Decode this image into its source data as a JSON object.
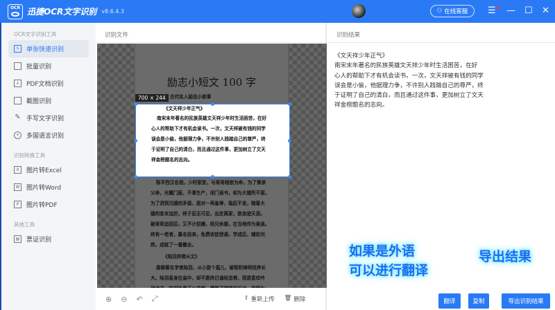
{
  "app": {
    "logo_text": "OCR",
    "title": "迅捷OCR文字识别",
    "version": "v8.6.4.3",
    "service": "在线客服",
    "menu_icon": "menu-icon",
    "min_icon": "minimize-icon",
    "max_icon": "maximize-icon",
    "close_icon": "close-icon"
  },
  "sidebar": {
    "sections": [
      {
        "title": "OCR文字识别工具",
        "items": [
          {
            "label": "单张快速识别",
            "active": true
          },
          {
            "label": "批量识别"
          },
          {
            "label": "PDF文档识别"
          },
          {
            "label": "截图识别"
          },
          {
            "label": "手写文字识别"
          },
          {
            "label": "多国语言识别"
          }
        ]
      },
      {
        "title": "识别转换工具",
        "items": [
          {
            "label": "图片转Excel",
            "icon_letter": "X"
          },
          {
            "label": "图片转Word",
            "icon_letter": "W"
          },
          {
            "label": "图片转PDF",
            "icon_letter": "P"
          }
        ]
      },
      {
        "title": "其他工具",
        "items": [
          {
            "label": "票证识别"
          }
        ]
      }
    ]
  },
  "file_panel": {
    "title": "识别文件",
    "selection_size": "700 × 244",
    "doc": {
      "title": "励志小短文 100 字",
      "lines": [
        "古代名人励志小故事",
        "《文天祥少年正气》",
        "南宋末年著名的民族英雄文天祥少年时生活困苦，在好",
        "心人的帮助下才有机会读书。一次，文天祥被有钱的同学",
        "误会是小偷，他据理力争，不许别人践踏自己的尊严，终",
        "于证明了自己的清白，而且通过这件事，更加树立了文天",
        "祥金榜题名的志向。",
        "《陈平忍辱苦读书》",
        "陈平西汉名相，少时家贫，与哥哥相依为命，为了秉承",
        "父命，光耀门庭，不事生产，闭门读书，却为大嫂所不容。",
        "为了消弭兄嫂的矛盾，面对一再羞辱，隐忍不发，随着大",
        "嫂的变本加厉，终于忍无可忍，出走离家，欲浪迹天涯。",
        "被哥哥追回后，又不计前嫌，阻兄休嫂，在当地传为美谈。",
        "终有一老者，慕名前来，免费收徒授课，学成后，辅佐刘",
        "邦，成就了一番霸业。",
        "《陆羽弃佛从文》",
        "唐朝著名学者陆羽，从小是个孤儿，被智积禅师抚养长",
        "大。陆羽虽身在庙中，却不愿终日诵经念佛，而是喜欢吟",
        "读诗书。陆羽执意下山求学，遭到了禅师的反对。禅师为"
      ]
    },
    "toolbar": {
      "zoom_in": "zoom-in-icon",
      "zoom_out": "zoom-out-icon",
      "rotate": "rotate-icon",
      "fit": "fit-icon",
      "reupload": "重新上传",
      "delete": "删除"
    }
  },
  "result_panel": {
    "title": "识别结果",
    "lines": [
      "《文天祥少年正气》",
      "南宋末年著名的民族英雄文天祥少年时生活困苦，在好",
      "心人的帮助下才有机会读书。一次，文天祥被有钱的同学",
      "误会是小偷，他据理力争，不许别人践踏自己的尊严，终",
      "于证明了自己的清白，而且通过这件事，更加树立了文天",
      "祥金榜题名的志向。"
    ],
    "translate": "翻译",
    "copy": "复制",
    "export": "导出识别结果"
  },
  "annotations": {
    "line1": "如果是外语",
    "line2": "可以进行翻译",
    "export_hint": "导出结果"
  },
  "colors": {
    "accent": "#2a7af5"
  }
}
